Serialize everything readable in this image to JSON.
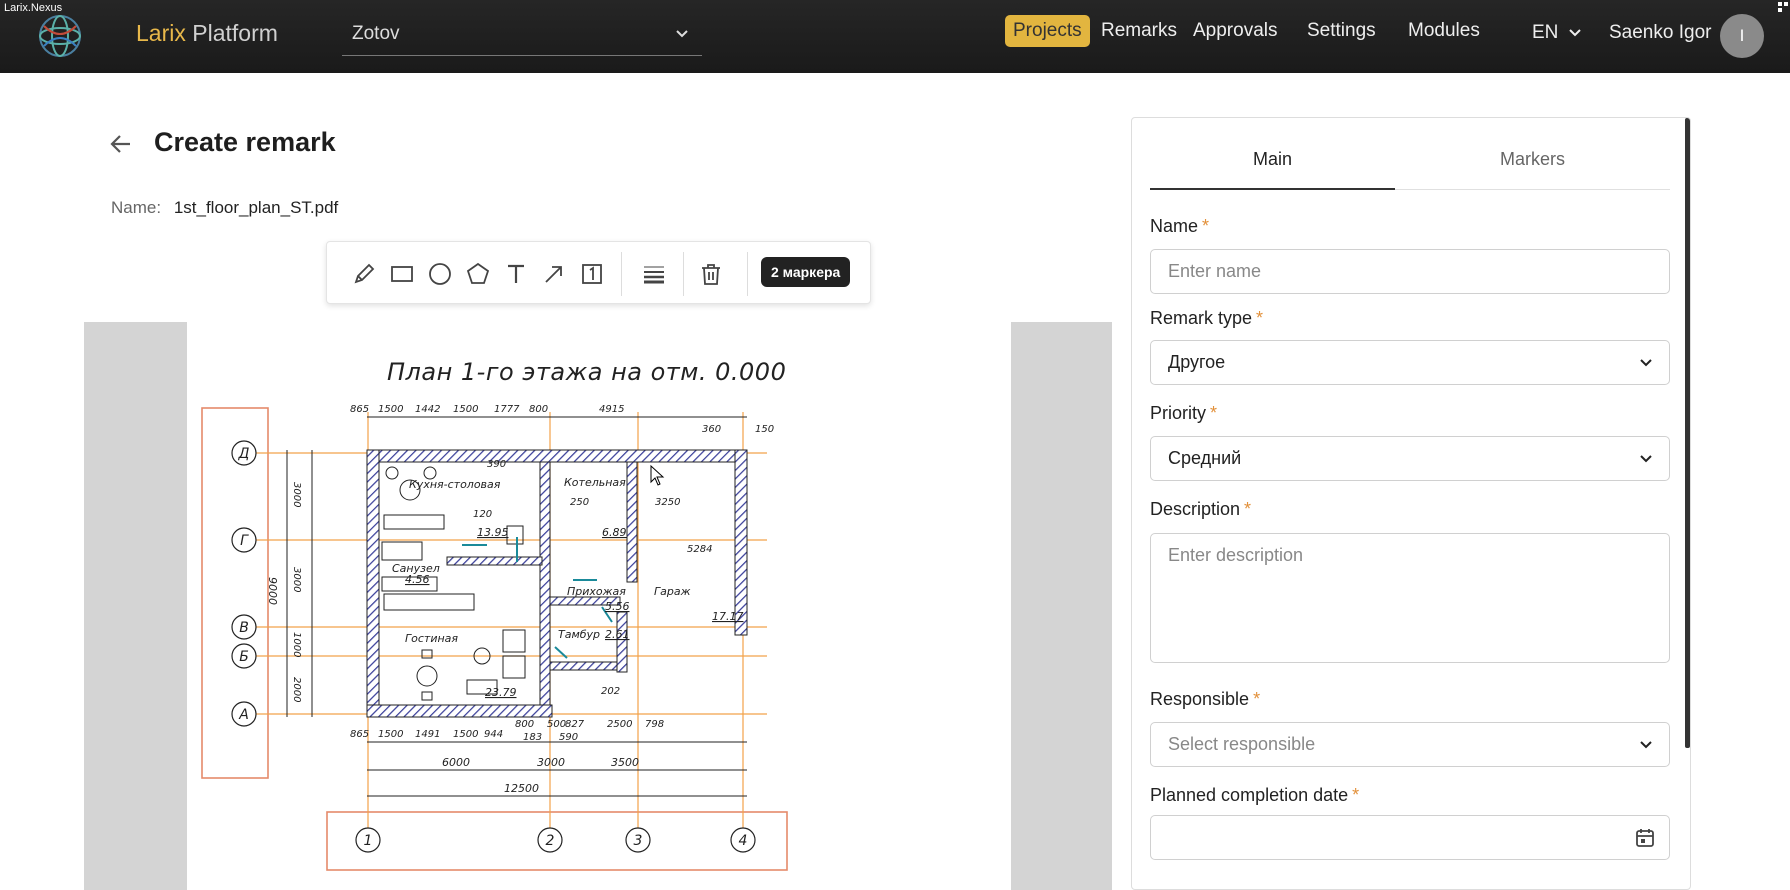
{
  "window": {
    "title": "Larix.Nexus"
  },
  "header": {
    "brand_word1": "Larix",
    "brand_word2": "Platform",
    "project": "Zotov",
    "nav": {
      "projects": "Projects",
      "remarks": "Remarks",
      "approvals": "Approvals",
      "settings": "Settings",
      "modules": "Modules"
    },
    "language": "EN",
    "user_name": "Saenko Igor",
    "avatar_initial": "I"
  },
  "page": {
    "title": "Create remark",
    "name_label": "Name:",
    "file_name": "1st_floor_plan_ST.pdf"
  },
  "toolbar": {
    "tools": [
      "pencil-icon",
      "rectangle-icon",
      "circle-icon",
      "polygon-icon",
      "text-icon",
      "arrow-icon",
      "numbered-marker-icon",
      "line-weight-icon",
      "trash-icon"
    ],
    "marker_count": "2 маркера"
  },
  "drawing": {
    "title": "План 1-го этажа на отм. 0.000",
    "rooms": [
      "Кухня-столовая",
      "Котельная",
      "Санузел",
      "Прихожая",
      "Гараж",
      "Гостиная",
      "Тамбур"
    ],
    "areas": [
      "13.95",
      "6.89",
      "4.56",
      "5.56",
      "2.61",
      "23.79",
      "17.17"
    ],
    "axes_letters": [
      "Д",
      "Г",
      "В",
      "Б",
      "А"
    ],
    "axes_numbers": [
      "1",
      "2",
      "3",
      "4"
    ],
    "top_dims": [
      "865",
      "1500",
      "1442",
      "1500",
      "1777",
      "800",
      "4915",
      "360",
      "150"
    ],
    "bottom_dims": [
      "865",
      "1500",
      "1491",
      "1500",
      "944",
      "800",
      "500",
      "827",
      "2500",
      "798",
      "183",
      "590",
      "202"
    ],
    "totals": [
      "6000",
      "3000",
      "3500",
      "12500",
      "9000"
    ],
    "vert_dims": [
      "3000",
      "3000",
      "1000",
      "2000"
    ],
    "inner_dims": [
      "390",
      "250",
      "3250",
      "5284",
      "120"
    ]
  },
  "form": {
    "tabs": {
      "main": "Main",
      "markers": "Markers"
    },
    "name": {
      "label": "Name",
      "placeholder": "Enter name"
    },
    "remark_type": {
      "label": "Remark type",
      "value": "Другое"
    },
    "priority": {
      "label": "Priority",
      "value": "Средний"
    },
    "description": {
      "label": "Description",
      "placeholder": "Enter description"
    },
    "responsible": {
      "label": "Responsible",
      "placeholder": "Select responsible"
    },
    "planned_date": {
      "label": "Planned completion date",
      "value": ""
    },
    "required_mark": "*"
  },
  "colors": {
    "accent": "#e2b53f",
    "topbar": "#1f1f1f",
    "required": "#e2903a",
    "hatch": "#3a3f9a",
    "axis_box": "#e58a6a",
    "axis_line": "#f2a24a"
  }
}
